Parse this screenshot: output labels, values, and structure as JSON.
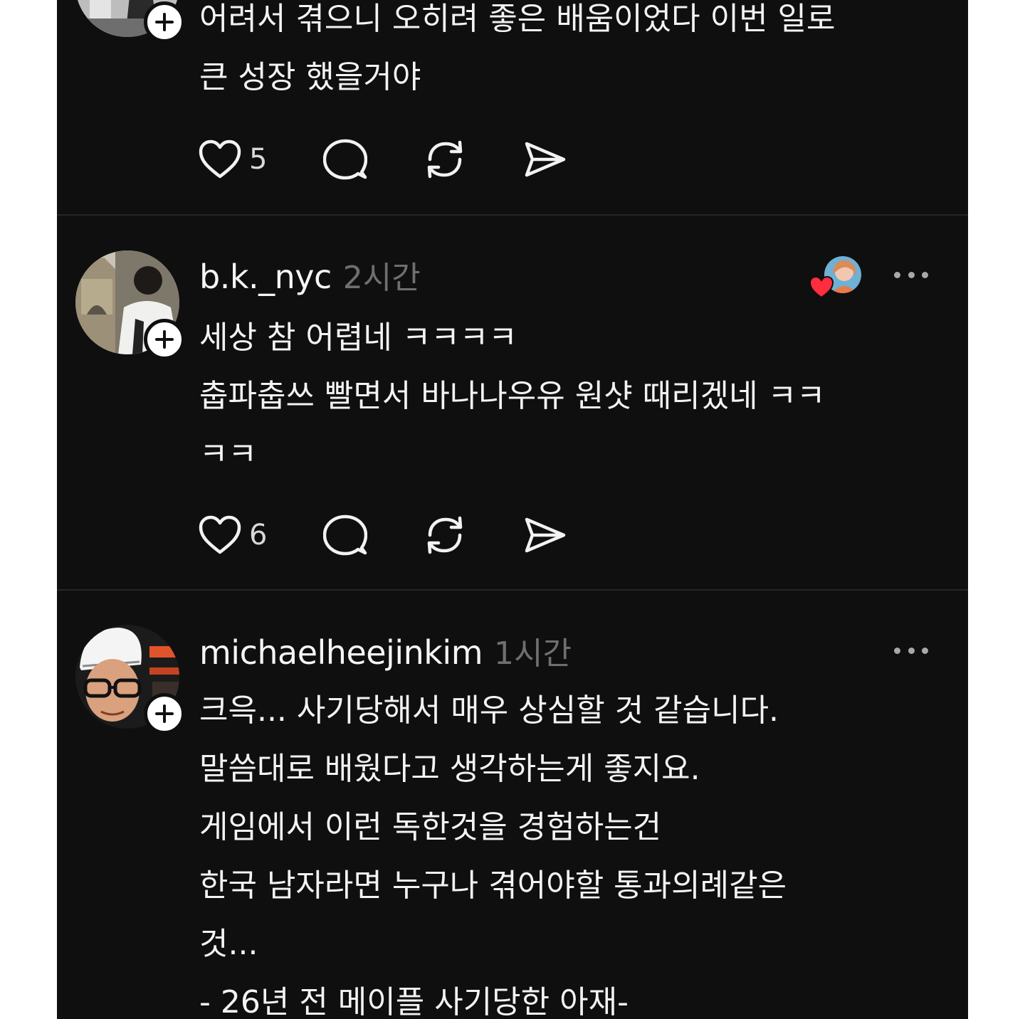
{
  "posts": [
    {
      "username": "",
      "time": "",
      "lines": [
        "어려서 겪으니 오히려 좋은 배움이었다 이번 일로",
        "큰 성장 했을거야"
      ],
      "like_count": "5",
      "avatar": "avatar-bw-photo"
    },
    {
      "username": "b.k._nyc",
      "time": "2시간",
      "lines": [
        "세상 참 어렵네 ㅋㅋㅋㅋ",
        "춥파춥쓰 빨면서 바나나우유 원샷 때리겠네 ㅋㅋ",
        "ㅋㅋ"
      ],
      "like_count": "6",
      "avatar": "avatar-tower-bridge-photo",
      "liked_by_author": true
    },
    {
      "username": "michaelheejinkim",
      "time": "1시간",
      "lines": [
        "크윽... 사기당해서 매우 상심할 것 같습니다.",
        "말씀대로 배웠다고 생각하는게 좋지요.",
        "게임에서 이런 독한것을 경험하는건",
        "한국 남자라면 누구나 겪어야할 통과의례같은",
        "것...",
        "- 26년 전 메이플 사기당한 아재-"
      ],
      "avatar": "avatar-cyclist-helmet-photo"
    }
  ],
  "icons": {
    "like": "heart-outline-icon",
    "comment": "speech-bubble-icon",
    "repost": "repost-arrows-icon",
    "share": "paper-plane-icon",
    "follow": "plus-icon",
    "more": "ellipsis-icon"
  },
  "colors": {
    "background": "#0f0f0f",
    "text": "#f3f3f3",
    "muted": "#6f6f6f",
    "divider": "#262626",
    "heart_badge": "#ff2d3d"
  }
}
